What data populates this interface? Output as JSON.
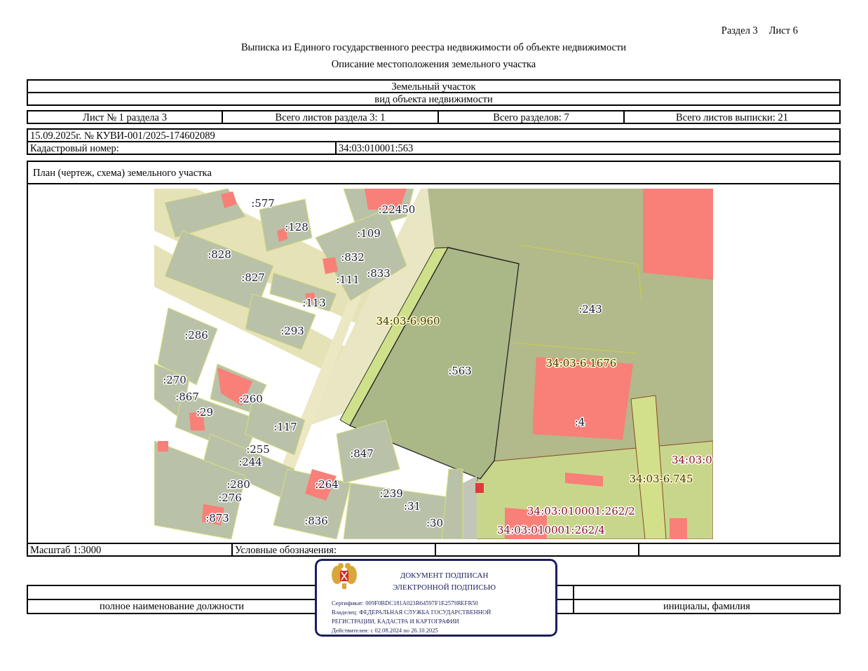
{
  "header": {
    "section": "Раздел 3",
    "sheet": "Лист 6"
  },
  "title": "Выписка из Единого государственного реестра недвижимости об объекте недвижимости",
  "subtitle": "Описание местоположения земельного участка",
  "object_block": {
    "value": "Земельный участок",
    "caption": "вид объекта недвижимости"
  },
  "sheet_info": [
    "Лист № 1 раздела 3",
    "Всего листов раздела 3: 1",
    "Всего разделов: 7",
    "Всего листов выписки: 21"
  ],
  "record": {
    "date_number": "15.09.2025г. № КУВИ-001/2025-174602089",
    "cadastral_label": "Кадастровый номер:",
    "cadastral_number": "34:03:010001:563"
  },
  "plan": {
    "heading": "План (чертеж, схема) земельного участка",
    "map_labels": [
      {
        "text": ":577",
        "kind": "parcel"
      },
      {
        "text": ":22450",
        "kind": "parcel"
      },
      {
        "text": ":128",
        "kind": "parcel"
      },
      {
        "text": ":109",
        "kind": "parcel"
      },
      {
        "text": ":828",
        "kind": "parcel"
      },
      {
        "text": ":832",
        "kind": "parcel"
      },
      {
        "text": ":827",
        "kind": "parcel"
      },
      {
        "text": ":111",
        "kind": "parcel"
      },
      {
        "text": ":833",
        "kind": "parcel"
      },
      {
        "text": ":113",
        "kind": "parcel"
      },
      {
        "text": "34:03-6.960",
        "kind": "quarter"
      },
      {
        "text": ":243",
        "kind": "parcel"
      },
      {
        "text": ":286",
        "kind": "parcel"
      },
      {
        "text": ":293",
        "kind": "parcel"
      },
      {
        "text": "34:03-6.1676",
        "kind": "quarter"
      },
      {
        "text": ":563",
        "kind": "parcel"
      },
      {
        "text": ":270",
        "kind": "parcel"
      },
      {
        "text": ":260",
        "kind": "parcel"
      },
      {
        "text": ":867",
        "kind": "parcel"
      },
      {
        "text": ":29",
        "kind": "parcel"
      },
      {
        "text": ":4",
        "kind": "parcel"
      },
      {
        "text": ":117",
        "kind": "parcel"
      },
      {
        "text": ":255",
        "kind": "parcel"
      },
      {
        "text": ":847",
        "kind": "parcel"
      },
      {
        "text": "34:03:0",
        "kind": "zone"
      },
      {
        "text": ":244",
        "kind": "parcel"
      },
      {
        "text": "34:03-6.745",
        "kind": "quarter"
      },
      {
        "text": ":280",
        "kind": "parcel"
      },
      {
        "text": ":264",
        "kind": "parcel"
      },
      {
        "text": ":239",
        "kind": "parcel"
      },
      {
        "text": ":276",
        "kind": "parcel"
      },
      {
        "text": ":31",
        "kind": "parcel"
      },
      {
        "text": "34:03:010001:262/2",
        "kind": "zone"
      },
      {
        "text": ":873",
        "kind": "parcel"
      },
      {
        "text": ":836",
        "kind": "parcel"
      },
      {
        "text": ":30",
        "kind": "parcel"
      },
      {
        "text": "34:03:010001:262/4",
        "kind": "zone"
      }
    ]
  },
  "scale": "Масштаб 1:3000",
  "legend_label": "Условные обозначения:",
  "signature": {
    "position_caption": "полное наименование должности",
    "name_caption": "инициалы, фамилия"
  },
  "stamp": {
    "title_lines": [
      "ДОКУМЕНТ ПОДПИСАН",
      "ЭЛЕКТРОННОЙ ПОДПИСЬЮ"
    ],
    "details": [
      "Сертификат: 009F0BDC181A023B64597F1E2579BEFB50",
      "Владелец: ФЕДЕРАЛЬНАЯ СЛУЖБА ГОСУДАРСТВЕННОЙ",
      "РЕГИСТРАЦИИ, КАДАСТРА И КАРТОГРАФИИ",
      "Действителен: с 02.08.2024 по 26.10.2025"
    ]
  }
}
